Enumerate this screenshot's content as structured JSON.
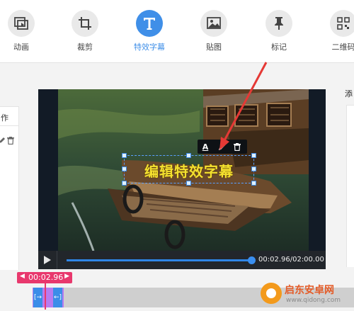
{
  "toolbar": {
    "items": [
      {
        "label": "动画",
        "icon": "animation-icon"
      },
      {
        "label": "裁剪",
        "icon": "crop-icon"
      },
      {
        "label": "特效字幕",
        "icon": "text-icon",
        "active": true
      },
      {
        "label": "贴图",
        "icon": "image-icon"
      },
      {
        "label": "标记",
        "icon": "pin-icon"
      },
      {
        "label": "二维码",
        "icon": "qrcode-icon"
      }
    ],
    "active_color": "#3f8fe8"
  },
  "left_panel": {
    "header": "作"
  },
  "right_panel": {
    "header": "添"
  },
  "caption": {
    "text": "编辑特效字幕",
    "text_color": "#f4e12f",
    "toolbar": {
      "font_icon": "A"
    }
  },
  "player": {
    "time_readout": "00:02.96/02:00.00",
    "progress": 0.025
  },
  "timeline": {
    "current_time": "00:02.96",
    "flag_color": "#e8386d",
    "clip_color": "#b77bf0",
    "handle_color": "#3b8de8"
  },
  "watermark": {
    "name": "启东安卓网",
    "url": "www.qidong.com"
  }
}
